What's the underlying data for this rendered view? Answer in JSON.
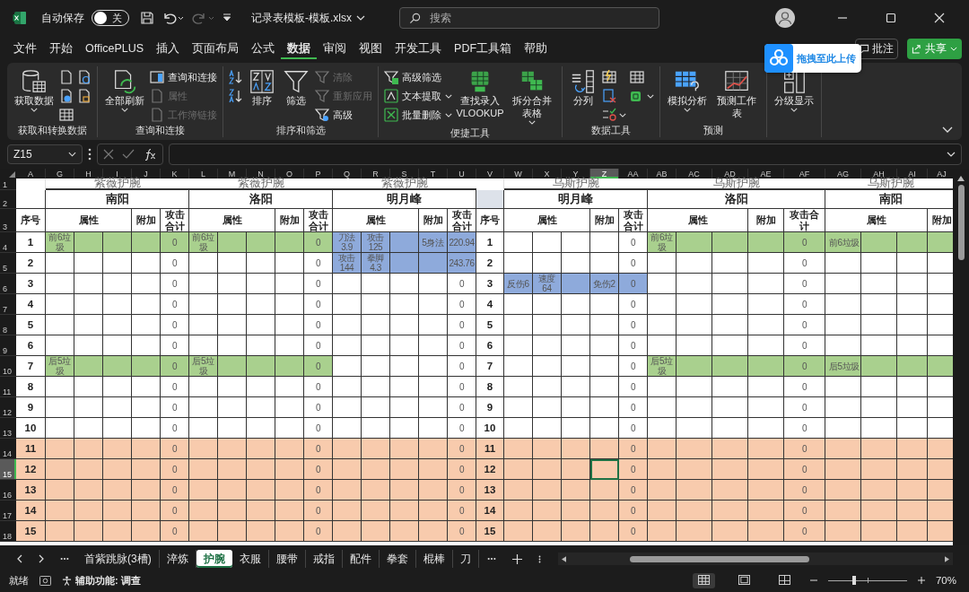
{
  "window": {
    "autosave_label": "自动保存",
    "autosave": {
      "on": false,
      "label": "关"
    },
    "undo": {
      "disabled": false
    },
    "redo": {
      "disabled": true
    },
    "filename": "记录表模板-模板.xlsx",
    "search_placeholder": "搜索"
  },
  "menu": {
    "tabs": [
      {
        "label": "文件",
        "selected": false
      },
      {
        "label": "开始",
        "selected": false
      },
      {
        "label": "OfficePLUS",
        "selected": false
      },
      {
        "label": "插入",
        "selected": false
      },
      {
        "label": "页面布局",
        "selected": false
      },
      {
        "label": "公式",
        "selected": false
      },
      {
        "label": "数据",
        "selected": true
      },
      {
        "label": "审阅",
        "selected": false
      },
      {
        "label": "视图",
        "selected": false
      },
      {
        "label": "开发工具",
        "selected": false
      },
      {
        "label": "PDF工具箱",
        "selected": false
      },
      {
        "label": "帮助",
        "selected": false
      }
    ],
    "comment_button": "批注",
    "share_button": "共享"
  },
  "upload_popup": {
    "label": "拖拽至此上传"
  },
  "ribbon": {
    "groups": [
      {
        "label": "获取和转换数据",
        "items": [
          {
            "kind": "large",
            "label": "获取数据",
            "caret": true
          },
          {
            "kind": "icon"
          },
          {
            "kind": "icon"
          },
          {
            "kind": "icon"
          },
          {
            "kind": "icon"
          },
          {
            "kind": "icon"
          }
        ]
      },
      {
        "label": "查询和连接",
        "items": [
          {
            "kind": "large",
            "label": "全部刷新",
            "caret": true
          },
          {
            "kind": "small",
            "label": "查询和连接",
            "disabled": false
          },
          {
            "kind": "small",
            "label": "属性",
            "disabled": true
          },
          {
            "kind": "small",
            "label": "工作簿链接",
            "disabled": true
          }
        ]
      },
      {
        "label": "排序和筛选",
        "items": [
          {
            "kind": "icon"
          },
          {
            "kind": "icon"
          },
          {
            "kind": "large",
            "label": "排序"
          },
          {
            "kind": "large",
            "label": "筛选"
          },
          {
            "kind": "small",
            "label": "清除",
            "disabled": true
          },
          {
            "kind": "small",
            "label": "重新应用",
            "disabled": true
          },
          {
            "kind": "small",
            "label": "高级",
            "disabled": false
          }
        ]
      },
      {
        "label": "便捷工具",
        "items": [
          {
            "kind": "small",
            "label": "高级筛选",
            "disabled": false
          },
          {
            "kind": "small",
            "label": "文本提取",
            "disabled": false,
            "caret": true
          },
          {
            "kind": "small",
            "label": "批量删除",
            "disabled": false,
            "caret": true
          },
          {
            "kind": "large",
            "label": "查找录入 VLOOKUP"
          },
          {
            "kind": "large",
            "label": "拆分合并表格",
            "caret": true
          }
        ]
      },
      {
        "label": "数据工具",
        "items": [
          {
            "kind": "large",
            "label": "分列"
          },
          {
            "kind": "icon"
          },
          {
            "kind": "icon"
          },
          {
            "kind": "icon",
            "caret": true
          },
          {
            "kind": "icon"
          },
          {
            "kind": "icon",
            "caret": true
          }
        ]
      },
      {
        "label": "预测",
        "items": [
          {
            "kind": "large",
            "label": "模拟分析",
            "caret": true
          },
          {
            "kind": "large",
            "label": "预测工作表"
          }
        ]
      },
      {
        "items": [
          {
            "kind": "large",
            "label": "分级显示",
            "caret": true
          }
        ]
      }
    ]
  },
  "formula_bar": {
    "name_box": "Z15"
  },
  "sheet": {
    "column_headers": [
      {
        "label": "A",
        "selected": false
      },
      {
        "label": "G",
        "selected": false
      },
      {
        "label": "H",
        "selected": false
      },
      {
        "label": "I",
        "selected": false
      },
      {
        "label": "J",
        "selected": false
      },
      {
        "label": "K",
        "selected": false
      },
      {
        "label": "L",
        "selected": false
      },
      {
        "label": "M",
        "selected": false
      },
      {
        "label": "N",
        "selected": false
      },
      {
        "label": "O",
        "selected": false
      },
      {
        "label": "P",
        "selected": false
      },
      {
        "label": "Q",
        "selected": false
      },
      {
        "label": "R",
        "selected": false
      },
      {
        "label": "S",
        "selected": false
      },
      {
        "label": "T",
        "selected": false
      },
      {
        "label": "U",
        "selected": false
      },
      {
        "label": "V",
        "selected": false
      },
      {
        "label": "W",
        "selected": false
      },
      {
        "label": "X",
        "selected": false
      },
      {
        "label": "Y",
        "selected": false
      },
      {
        "label": "Z",
        "selected": true
      },
      {
        "label": "AA",
        "selected": false
      },
      {
        "label": "AB",
        "selected": false
      },
      {
        "label": "AC",
        "selected": false
      },
      {
        "label": "AD",
        "selected": false
      },
      {
        "label": "AE",
        "selected": false
      },
      {
        "label": "AF",
        "selected": false
      },
      {
        "label": "AG",
        "selected": false
      },
      {
        "label": "AH",
        "selected": false
      },
      {
        "label": "AI",
        "selected": false
      },
      {
        "label": "AJ",
        "selected": false
      }
    ],
    "row_headers": [
      {
        "label": "1",
        "selected": false
      },
      {
        "label": "2",
        "selected": false
      },
      {
        "label": "3",
        "selected": false
      },
      {
        "label": "4",
        "selected": false
      },
      {
        "label": "5",
        "selected": false
      },
      {
        "label": "6",
        "selected": false
      },
      {
        "label": "7",
        "selected": false
      },
      {
        "label": "8",
        "selected": false
      },
      {
        "label": "9",
        "selected": false
      },
      {
        "label": "10",
        "selected": false
      },
      {
        "label": "11",
        "selected": false
      },
      {
        "label": "12",
        "selected": false
      },
      {
        "label": "13",
        "selected": false
      },
      {
        "label": "14",
        "selected": false
      },
      {
        "label": "15",
        "selected": true
      },
      {
        "label": "16",
        "selected": false
      },
      {
        "label": "17",
        "selected": false
      },
      {
        "label": "18",
        "selected": false
      }
    ],
    "sections": [
      {
        "kind": "seq",
        "heading": "序号",
        "cells": [
          {
            "text": "1"
          },
          {
            "text": "2"
          },
          {
            "text": "3"
          },
          {
            "text": "4"
          },
          {
            "text": "5"
          },
          {
            "text": "6"
          },
          {
            "text": "7"
          },
          {
            "text": "8"
          },
          {
            "text": "9"
          },
          {
            "text": "10"
          },
          {
            "text": "11",
            "color": "#f8cbad"
          },
          {
            "text": "12",
            "color": "#f8cbad"
          },
          {
            "text": "13",
            "color": "#f8cbad"
          },
          {
            "text": "14",
            "color": "#f8cbad"
          },
          {
            "text": "15",
            "color": "#f8cbad"
          }
        ]
      },
      {
        "kind": "block",
        "title": "紫薇护腕",
        "region": "南阳",
        "headers": {
          "attributes": "属性",
          "extra": "附加",
          "total": "攻击合计"
        },
        "rows": [
          {
            "attr_1": "前6垃圾",
            "total": "0",
            "color": "#a9d08e"
          },
          {
            "total": "0"
          },
          {
            "total": "0"
          },
          {
            "total": "0"
          },
          {
            "total": "0"
          },
          {
            "total": "0"
          },
          {
            "attr_1": "后5垃圾",
            "total": "0",
            "color": "#a9d08e"
          },
          {
            "total": "0"
          },
          {
            "total": "0"
          },
          {
            "total": "0"
          },
          {
            "total": "0",
            "color": "#f8cbad"
          },
          {
            "total": "0",
            "color": "#f8cbad"
          },
          {
            "total": "0",
            "color": "#f8cbad"
          },
          {
            "total": "0",
            "color": "#f8cbad"
          },
          {
            "total": "0",
            "color": "#f8cbad"
          }
        ]
      },
      {
        "kind": "block",
        "title": "紫薇护腕",
        "region": "洛阳",
        "headers": {
          "attributes": "属性",
          "extra": "附加",
          "total": "攻击合计"
        },
        "rows": [
          {
            "attr_1": "前6垃圾",
            "total": "0",
            "color": "#a9d08e"
          },
          {
            "total": "0"
          },
          {
            "total": "0"
          },
          {
            "total": "0"
          },
          {
            "total": "0"
          },
          {
            "total": "0"
          },
          {
            "attr_1": "后5垃圾",
            "total": "0",
            "color": "#a9d08e"
          },
          {
            "total": "0"
          },
          {
            "total": "0"
          },
          {
            "total": "0"
          },
          {
            "total": "0",
            "color": "#f8cbad"
          },
          {
            "total": "0",
            "color": "#f8cbad"
          },
          {
            "total": "0",
            "color": "#f8cbad"
          },
          {
            "total": "0",
            "color": "#f8cbad"
          },
          {
            "total": "0",
            "color": "#f8cbad"
          }
        ]
      },
      {
        "kind": "block",
        "title": "紫薇护腕",
        "region": "明月峰",
        "headers": {
          "attributes": "属性",
          "extra": "附加",
          "total": "攻击合计"
        },
        "rows": [
          {
            "attr_1": "刀法3.9",
            "attr_2": "攻击125",
            "extra": "5身法",
            "total": "220.94",
            "color": "#8eaadb"
          },
          {
            "attr_1": "攻击144",
            "attr_2": "拳脚4.3",
            "total": "243.76",
            "color": "#8eaadb"
          },
          {
            "total": "0"
          },
          {
            "total": "0"
          },
          {
            "total": "0"
          },
          {
            "total": "0"
          },
          {
            "total": "0"
          },
          {
            "total": "0"
          },
          {
            "total": "0"
          },
          {
            "total": "0"
          },
          {
            "total": "0",
            "color": "#f8cbad"
          },
          {
            "total": "0",
            "color": "#f8cbad"
          },
          {
            "total": "0",
            "color": "#f8cbad"
          },
          {
            "total": "0",
            "color": "#f8cbad"
          },
          {
            "total": "0",
            "color": "#f8cbad"
          }
        ]
      },
      {
        "kind": "seq",
        "heading": "序号",
        "shaded": true,
        "cells": [
          {
            "text": "1"
          },
          {
            "text": "2"
          },
          {
            "text": "3"
          },
          {
            "text": "4"
          },
          {
            "text": "5"
          },
          {
            "text": "6"
          },
          {
            "text": "7"
          },
          {
            "text": "8"
          },
          {
            "text": "9"
          },
          {
            "text": "10"
          },
          {
            "text": "11",
            "color": "#f8cbad"
          },
          {
            "text": "12",
            "color": "#f8cbad"
          },
          {
            "text": "13",
            "color": "#f8cbad"
          },
          {
            "text": "14",
            "color": "#f8cbad"
          },
          {
            "text": "15",
            "color": "#f8cbad"
          }
        ]
      },
      {
        "kind": "block",
        "title": "乌斯护腕",
        "region": "明月峰",
        "headers": {
          "attributes": "属性",
          "extra": "附加",
          "total": "攻击合计"
        },
        "rows": [
          {
            "total": "0"
          },
          {
            "total": "0"
          },
          {
            "attr_1": "反伤6",
            "attr_2": "速度64",
            "extra": "免伤2",
            "total": "0",
            "color": "#8eaadb"
          },
          {
            "total": "0"
          },
          {
            "total": "0"
          },
          {
            "total": "0"
          },
          {
            "total": "0"
          },
          {
            "total": "0"
          },
          {
            "total": "0"
          },
          {
            "total": "0"
          },
          {
            "total": "0",
            "color": "#f8cbad"
          },
          {
            "total": "0",
            "color": "#f8cbad"
          },
          {
            "total": "0",
            "color": "#f8cbad"
          },
          {
            "total": "0",
            "color": "#f8cbad"
          },
          {
            "total": "0",
            "color": "#f8cbad"
          }
        ]
      },
      {
        "kind": "block",
        "title": "乌斯护腕",
        "region": "洛阳",
        "headers": {
          "attributes": "属性",
          "extra": "附加",
          "total": "攻击合计"
        },
        "rows": [
          {
            "attr_1": "前6垃圾",
            "total": "0",
            "color": "#a9d08e"
          },
          {
            "total": "0"
          },
          {
            "total": "0"
          },
          {
            "total": "0"
          },
          {
            "total": "0"
          },
          {
            "total": "0"
          },
          {
            "attr_1": "后5垃圾",
            "total": "0",
            "color": "#a9d08e"
          },
          {
            "total": "0"
          },
          {
            "total": "0"
          },
          {
            "total": "0"
          },
          {
            "total": "0",
            "color": "#f8cbad"
          },
          {
            "total": "0",
            "color": "#f8cbad"
          },
          {
            "total": "0",
            "color": "#f8cbad"
          },
          {
            "total": "0",
            "color": "#f8cbad"
          },
          {
            "total": "0",
            "color": "#f8cbad"
          }
        ]
      },
      {
        "kind": "block",
        "title": "乌斯护腕",
        "region": "南阳",
        "headers": {
          "attributes": "属性",
          "extra": "附加"
        },
        "rows": [
          {
            "attr_1": "前6垃圾",
            "color": "#a9d08e"
          },
          {},
          {},
          {},
          {},
          {},
          {
            "attr_1": "后5垃圾",
            "color": "#a9d08e"
          },
          {},
          {},
          {},
          {
            "color": "#f8cbad"
          },
          {
            "color": "#f8cbad"
          },
          {
            "color": "#f8cbad"
          },
          {
            "color": "#f8cbad"
          },
          {
            "color": "#f8cbad"
          }
        ]
      }
    ]
  },
  "sheet_tabs": [
    {
      "label": "首紫跳脉(3槽)",
      "selected": false
    },
    {
      "label": "淬炼",
      "selected": false
    },
    {
      "label": "护腕",
      "selected": true
    },
    {
      "label": "衣服",
      "selected": false
    },
    {
      "label": "腰带",
      "selected": false
    },
    {
      "label": "戒指",
      "selected": false
    },
    {
      "label": "配件",
      "selected": false
    },
    {
      "label": "拳套",
      "selected": false
    },
    {
      "label": "棍棒",
      "selected": false
    },
    {
      "label": "刀",
      "selected": false
    }
  ],
  "status_bar": {
    "ready": "就绪",
    "accessibility": "辅助功能: 调查",
    "views": [
      {
        "kind": "normal",
        "selected": true
      },
      {
        "kind": "page_layout",
        "selected": false
      },
      {
        "kind": "page_break",
        "selected": false
      }
    ],
    "zoom": {
      "level": 0.33,
      "reading": "70%"
    }
  }
}
